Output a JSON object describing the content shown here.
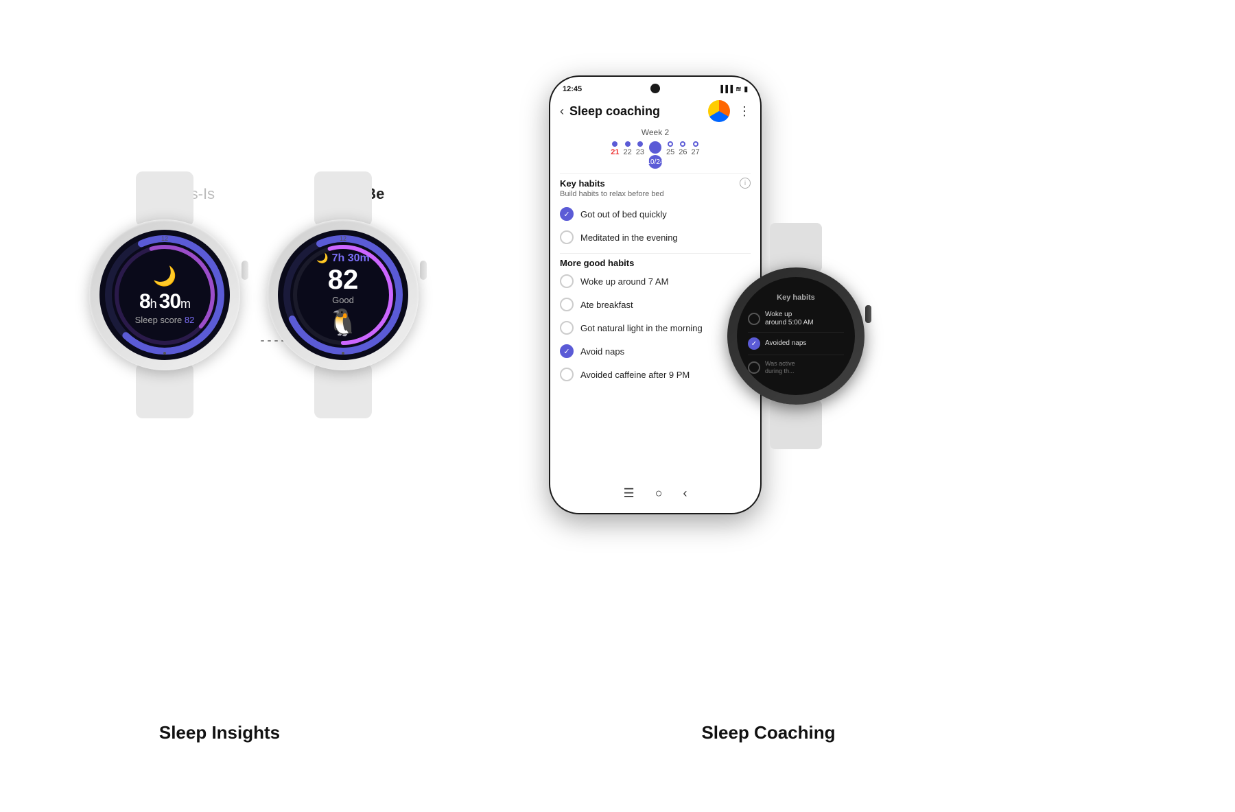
{
  "labels": {
    "asis": "As-Is",
    "tobe": "To-Be",
    "sleep_insights": "Sleep Insights",
    "sleep_coaching": "Sleep Coaching"
  },
  "watch1": {
    "time": "8h 30m",
    "time_h": "8",
    "time_m": "30",
    "score_label": "Sleep score ",
    "score_value": "82"
  },
  "watch2": {
    "duration": "7h 30m",
    "score": "82",
    "score_label": "Good"
  },
  "phone": {
    "status_time": "12:45",
    "title": "Sleep coaching",
    "week_label": "Week 2",
    "days": [
      {
        "num": "21",
        "style": "red",
        "dot": "sm"
      },
      {
        "num": "22",
        "style": "normal",
        "dot": "sm"
      },
      {
        "num": "23",
        "style": "normal",
        "dot": "sm"
      },
      {
        "num": "10/24",
        "style": "selected",
        "dot": "lg"
      },
      {
        "num": "25",
        "style": "normal",
        "dot": "empty"
      },
      {
        "num": "26",
        "style": "normal",
        "dot": "empty"
      },
      {
        "num": "27",
        "style": "normal",
        "dot": "empty"
      }
    ],
    "key_habits_title": "Key habits",
    "key_habits_sub": "Build habits to relax before bed",
    "key_habits": [
      {
        "text": "Got out of bed quickly",
        "checked": true
      },
      {
        "text": "Meditated in the evening",
        "checked": false
      }
    ],
    "more_habits_title": "More good habits",
    "more_habits": [
      {
        "text": "Woke up around 7 AM",
        "checked": false
      },
      {
        "text": "Ate breakfast",
        "checked": false
      },
      {
        "text": "Got natural light in the morning",
        "checked": false
      },
      {
        "text": "Avoid naps",
        "checked": true
      },
      {
        "text": "Avoided caffeine after 9 PM",
        "checked": false
      }
    ]
  },
  "watch3": {
    "title": "Key habits",
    "habits": [
      {
        "text": "Woke up\naround 5:00 AM",
        "checked": false
      },
      {
        "text": "Avoided naps",
        "checked": true
      },
      {
        "text": "Was active\nduring th...",
        "checked": false,
        "faded": true
      }
    ]
  }
}
